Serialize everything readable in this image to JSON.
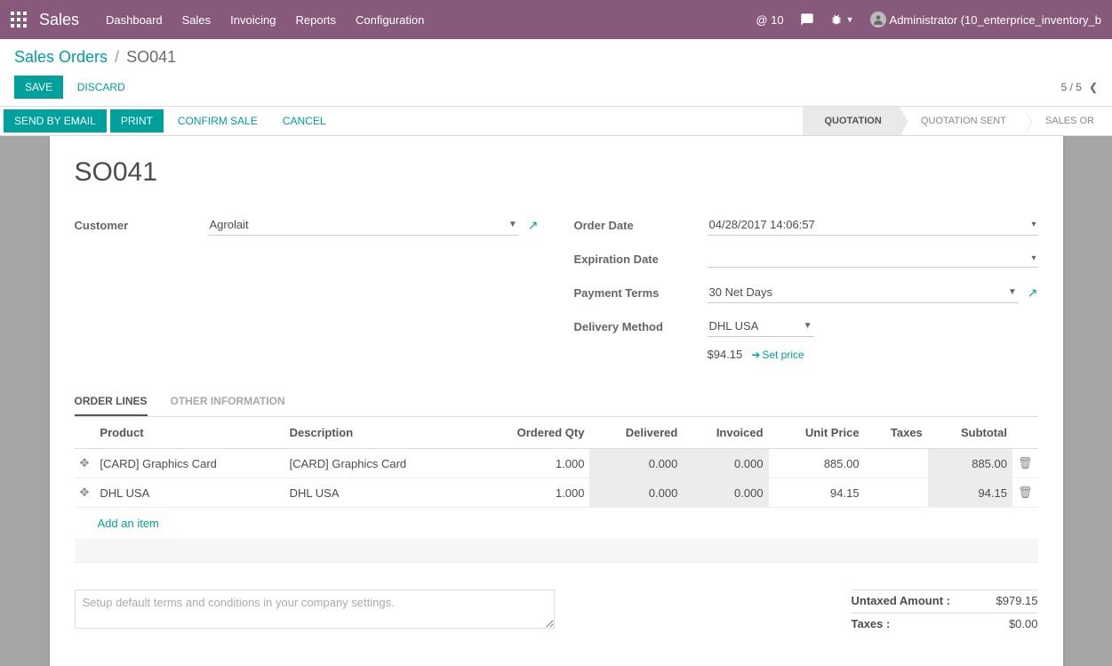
{
  "header": {
    "app": "Sales",
    "nav": [
      "Dashboard",
      "Sales",
      "Invoicing",
      "Reports",
      "Configuration"
    ],
    "mail_count": "@ 10",
    "user": "Administrator (10_enterprice_inventory_b"
  },
  "breadcrumb": {
    "root": "Sales Orders",
    "current": "SO041"
  },
  "buttons": {
    "save": "Save",
    "discard": "Discard"
  },
  "pager": {
    "text": "5 / 5"
  },
  "statusbar": {
    "left": [
      "Send by Email",
      "Print",
      "Confirm Sale",
      "Cancel"
    ],
    "steps": [
      "Quotation",
      "Quotation Sent",
      "Sales Or"
    ]
  },
  "form": {
    "title": "SO041",
    "customer_label": "Customer",
    "customer": "Agrolait",
    "order_date_label": "Order Date",
    "order_date": "04/28/2017 14:06:57",
    "expiration_label": "Expiration Date",
    "expiration": "",
    "payment_terms_label": "Payment Terms",
    "payment_terms": "30 Net Days",
    "delivery_method_label": "Delivery Method",
    "delivery_method": "DHL USA",
    "delivery_cost": "$94.15",
    "set_price": "Set price"
  },
  "tabs": [
    "Order Lines",
    "Other Information"
  ],
  "table": {
    "headers": {
      "product": "Product",
      "description": "Description",
      "ordered": "Ordered Qty",
      "delivered": "Delivered",
      "invoiced": "Invoiced",
      "unit_price": "Unit Price",
      "taxes": "Taxes",
      "subtotal": "Subtotal"
    },
    "rows": [
      {
        "product": "[CARD] Graphics Card",
        "description": "[CARD] Graphics Card",
        "ordered": "1.000",
        "delivered": "0.000",
        "invoiced": "0.000",
        "unit_price": "885.00",
        "taxes": "",
        "subtotal": "885.00"
      },
      {
        "product": "DHL USA",
        "description": "DHL USA",
        "ordered": "1.000",
        "delivered": "0.000",
        "invoiced": "0.000",
        "unit_price": "94.15",
        "taxes": "",
        "subtotal": "94.15"
      }
    ],
    "add_item": "Add an item"
  },
  "terms_placeholder": "Setup default terms and conditions in your company settings.",
  "totals": {
    "untaxed_label": "Untaxed Amount :",
    "untaxed": "$979.15",
    "taxes_label": "Taxes :",
    "taxes": "$0.00"
  }
}
